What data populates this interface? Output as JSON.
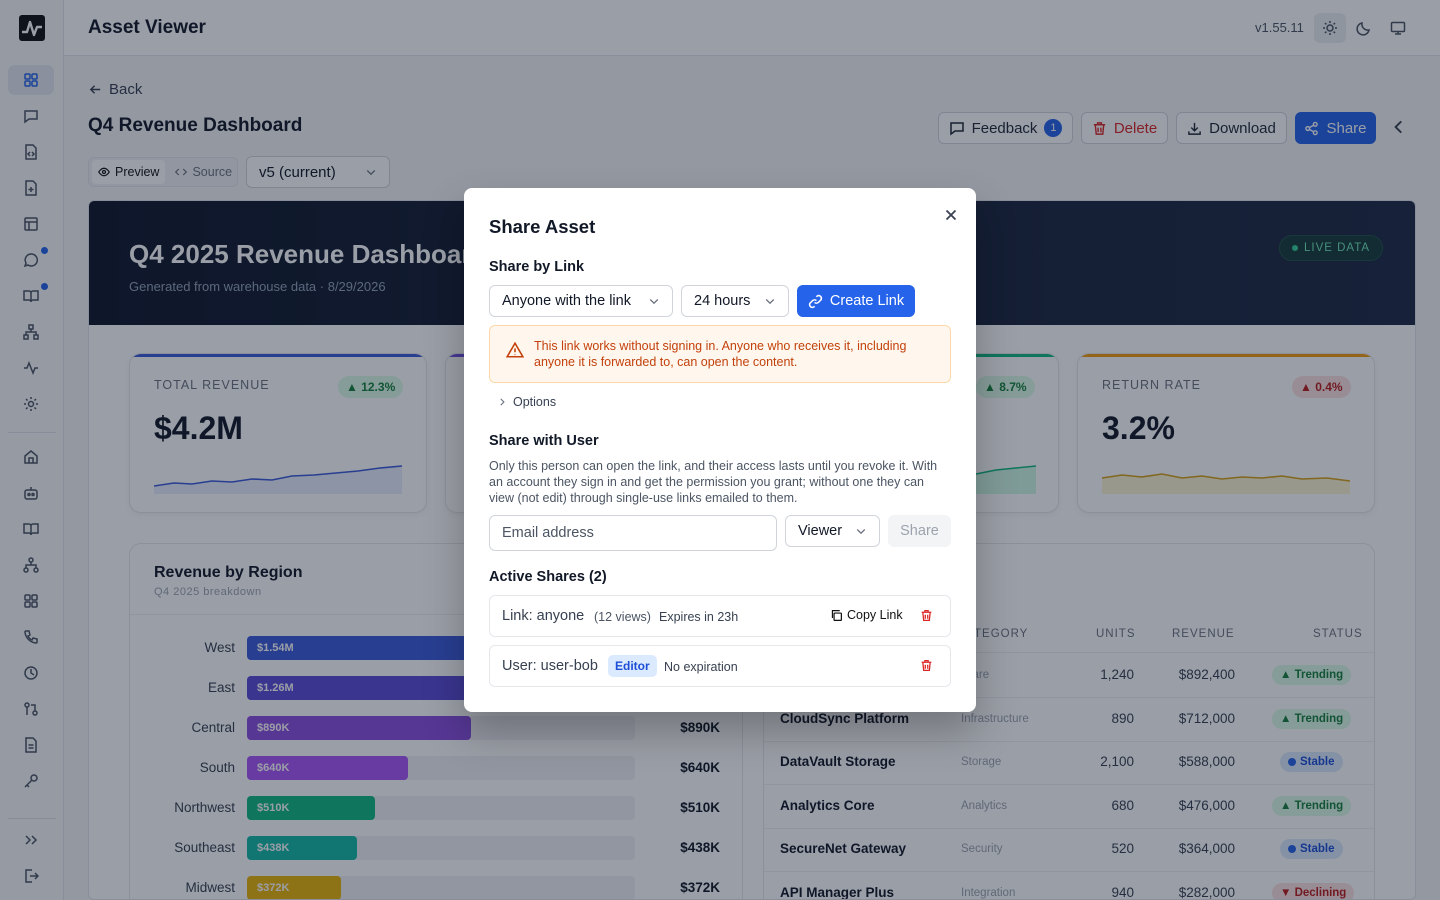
{
  "app": {
    "title": "Asset Viewer",
    "version": "v1.55.11"
  },
  "nav": {
    "back_label": "Back"
  },
  "page": {
    "title": "Q4 Revenue Dashboard",
    "feedback_label": "Feedback",
    "feedback_count": "1",
    "delete_label": "Delete",
    "download_label": "Download",
    "share_label": "Share",
    "mode_preview": "Preview",
    "mode_source": "Source",
    "version_select": "v5 (current)"
  },
  "dashboard": {
    "title": "Q4 2025 Revenue Dashboard",
    "subtitle": "Generated from warehouse data · 8/29/2026",
    "live_label": "LIVE DATA",
    "kpis": [
      {
        "label": "TOTAL REVENUE",
        "value": "$4.2M",
        "delta": "▲ 12.3%",
        "color": "#3b5bdb"
      },
      {
        "label": "",
        "value": "",
        "delta": "",
        "color": "#6d4ee0"
      },
      {
        "label": "",
        "value": "",
        "delta": "▲ 8.7%",
        "color": "#10b981"
      },
      {
        "label": "RETURN RATE",
        "value": "3.2%",
        "delta": "▲ 0.4%",
        "color": "#f59e0b"
      }
    ],
    "region": {
      "title": "Revenue by Region",
      "subtitle": "Q4 2025 breakdown",
      "max": 1540,
      "rows": [
        {
          "name": "West",
          "amount": 1540,
          "label": "$1.54M",
          "color": "#3b5bdb"
        },
        {
          "name": "East",
          "amount": 1260,
          "label": "$1.26M",
          "color": "#5b4ad8"
        },
        {
          "name": "Central",
          "amount": 890,
          "label": "$890K",
          "color": "#8b4ee0"
        },
        {
          "name": "South",
          "amount": 640,
          "label": "$640K",
          "color": "#a855f7"
        },
        {
          "name": "Northwest",
          "amount": 510,
          "label": "$510K",
          "color": "#10b981"
        },
        {
          "name": "Southeast",
          "amount": 438,
          "label": "$438K",
          "color": "#14b8a6"
        },
        {
          "name": "Midwest",
          "amount": 372,
          "label": "$372K",
          "color": "#eab308"
        }
      ]
    },
    "products": {
      "headers": {
        "category": "TEGORY",
        "units": "UNITS",
        "revenue": "REVENUE",
        "status": "STATUS"
      },
      "rows": [
        {
          "name": "",
          "category": "tware",
          "units": "1,240",
          "revenue": "$892,400",
          "status": "▲ Trending",
          "kind": "trending"
        },
        {
          "name": "CloudSync Platform",
          "category": "Infrastructure",
          "units": "890",
          "revenue": "$712,000",
          "status": "▲ Trending",
          "kind": "trending"
        },
        {
          "name": "DataVault Storage",
          "category": "Storage",
          "units": "2,100",
          "revenue": "$588,000",
          "status": "Stable",
          "kind": "stable"
        },
        {
          "name": "Analytics Core",
          "category": "Analytics",
          "units": "680",
          "revenue": "$476,000",
          "status": "▲ Trending",
          "kind": "trending"
        },
        {
          "name": "SecureNet Gateway",
          "category": "Security",
          "units": "520",
          "revenue": "$364,000",
          "status": "Stable",
          "kind": "stable"
        },
        {
          "name": "API Manager Plus",
          "category": "Integration",
          "units": "940",
          "revenue": "$282,000",
          "status": "▼ Declining",
          "kind": "declining"
        }
      ]
    }
  },
  "modal": {
    "title": "Share Asset",
    "link_heading": "Share by Link",
    "audience": "Anyone with the link",
    "duration": "24 hours",
    "create_label": "Create Link",
    "warning": "This link works without signing in. Anyone who receives it, including anyone it is forwarded to, can open the content.",
    "options_label": "Options",
    "user_heading": "Share with User",
    "user_desc": "Only this person can open the link, and their access lasts until you revoke it. With an account they sign in and get the permission you grant; without one they can view (not edit) through single-use links emailed to them.",
    "email_placeholder": "Email address",
    "role": "Viewer",
    "share_label": "Share",
    "active_heading": "Active Shares (2)",
    "shares": [
      {
        "main": "Link: anyone",
        "views": "(12 views)",
        "expiry": "Expires in 23h",
        "copy": "Copy Link"
      },
      {
        "main": "User: user-bob",
        "role": "Editor",
        "expiry": "No expiration"
      }
    ]
  }
}
